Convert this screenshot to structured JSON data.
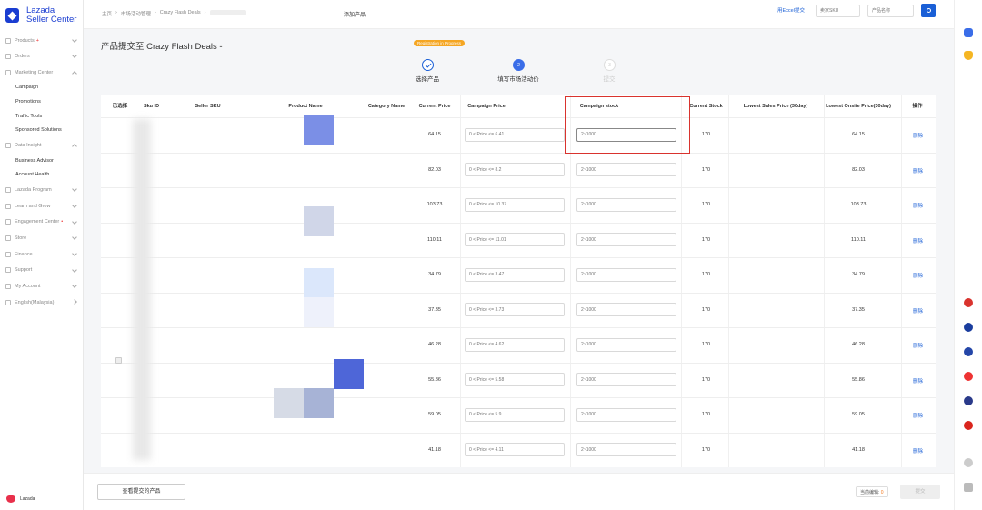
{
  "app": {
    "brand_line1": "Lazada",
    "brand_line2": "Seller Center",
    "footer_brand": "Lazada"
  },
  "sidebar": {
    "items": [
      {
        "label": "Products",
        "chevron": "down",
        "plus": "+"
      },
      {
        "label": "Orders",
        "chevron": "down"
      },
      {
        "label": "Marketing Center",
        "chevron": "up"
      },
      {
        "label": "Campaign",
        "sub": true
      },
      {
        "label": "Promotions",
        "sub": true
      },
      {
        "label": "Traffic Tools",
        "sub": true
      },
      {
        "label": "Sponsored Solutions",
        "sub": true
      },
      {
        "label": "Data Insight",
        "chevron": "up"
      },
      {
        "label": "Business Advisor",
        "sub": true
      },
      {
        "label": "Account Health",
        "sub": true
      },
      {
        "label": "Lazada Program",
        "chevron": "down"
      },
      {
        "label": "Learn and Grow",
        "chevron": "down"
      },
      {
        "label": "Engagement Center",
        "chevron": "down",
        "plus": "•"
      },
      {
        "label": "Store",
        "chevron": "down"
      },
      {
        "label": "Finance",
        "chevron": "down"
      },
      {
        "label": "Support",
        "chevron": "down"
      },
      {
        "label": "My Account",
        "chevron": "down"
      },
      {
        "label": "English(Malaysia)",
        "chevron": "right"
      }
    ]
  },
  "topbar": {
    "breadcrumb": [
      "主页",
      "›",
      "市场活动管理",
      "›",
      "Crazy Flash Deals",
      "›"
    ],
    "page_heading": "添加产品",
    "excel_link": "用Excel提交",
    "search_sku_placeholder": "卖家SKU",
    "search_name_placeholder": "产品名称"
  },
  "main": {
    "title": "产品提交至 Crazy Flash Deals -",
    "badge": "Registration in Progress",
    "steps": [
      {
        "label": "选择产品",
        "state": "done",
        "num": "1"
      },
      {
        "label": "填写市场活动价",
        "state": "current",
        "num": "2"
      },
      {
        "label": "提交",
        "state": "todo",
        "num": "3"
      }
    ]
  },
  "table": {
    "headers": {
      "select": "已选择",
      "sku_id": "Sku ID",
      "seller_sku": "Seller SKU",
      "product_name": "Product Name",
      "category": "Category Name",
      "current_price": "Current Price",
      "campaign_price": "Campaign Price",
      "campaign_stock": "Campaign stock",
      "current_stock": "Current Stock",
      "lowest_sales": "Lowest Sales Price (30day)",
      "lowest_onsite": "Lowest Onsite Price(30day)",
      "action": "操作"
    },
    "rows": [
      {
        "current_price": "64.15",
        "price_placeholder": "0 < Price <= 6.41",
        "stock_placeholder": "2~1000",
        "current_stock": "170",
        "lowest_onsite": "64.15",
        "action": "删除"
      },
      {
        "current_price": "82.03",
        "price_placeholder": "0 < Price <= 8.2",
        "stock_placeholder": "2~1000",
        "current_stock": "170",
        "lowest_onsite": "82.03",
        "action": "删除"
      },
      {
        "current_price": "103.73",
        "price_placeholder": "0 < Price <= 10.37",
        "stock_placeholder": "2~1000",
        "current_stock": "170",
        "lowest_onsite": "103.73",
        "action": "删除"
      },
      {
        "current_price": "110.11",
        "price_placeholder": "0 < Price <= 11.01",
        "stock_placeholder": "2~1000",
        "current_stock": "170",
        "lowest_onsite": "110.11",
        "action": "删除"
      },
      {
        "current_price": "34.79",
        "price_placeholder": "0 < Price <= 3.47",
        "stock_placeholder": "2~1000",
        "current_stock": "170",
        "lowest_onsite": "34.79",
        "action": "删除"
      },
      {
        "current_price": "37.35",
        "price_placeholder": "0 < Price <= 3.73",
        "stock_placeholder": "2~1000",
        "current_stock": "170",
        "lowest_onsite": "37.35",
        "action": "删除"
      },
      {
        "current_price": "46.28",
        "price_placeholder": "0 < Price <= 4.62",
        "stock_placeholder": "2~1000",
        "current_stock": "170",
        "lowest_onsite": "46.28",
        "action": "删除"
      },
      {
        "current_price": "55.86",
        "price_placeholder": "0 < Price <= 5.58",
        "stock_placeholder": "2~1000",
        "current_stock": "170",
        "lowest_onsite": "55.86",
        "action": "删除"
      },
      {
        "current_price": "59.05",
        "price_placeholder": "0 < Price <= 5.9",
        "stock_placeholder": "2~1000",
        "current_stock": "170",
        "lowest_onsite": "59.05",
        "action": "删除"
      },
      {
        "current_price": "41.18",
        "price_placeholder": "0 < Price <= 4.11",
        "stock_placeholder": "2~1000",
        "current_stock": "170",
        "lowest_onsite": "41.18",
        "action": "删除"
      }
    ]
  },
  "footer": {
    "view_button": "查看提交的产品",
    "count_label": "当前编辑:",
    "count_value": "0",
    "submit_button": "提交"
  },
  "colors": {
    "accent": "#1a5fd6",
    "highlight": "#d9332e",
    "badge": "#f5a623"
  }
}
